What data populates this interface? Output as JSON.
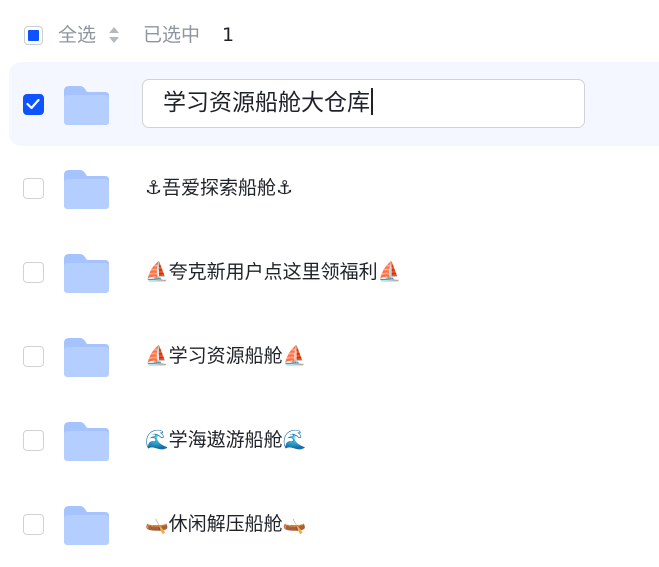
{
  "header": {
    "select_all_label": "全选",
    "selected_label": "已选中",
    "selected_count": "1"
  },
  "editing": {
    "value": "学习资源船舱大仓库"
  },
  "folders": [
    {
      "name": "⚓吾爱探索船舱⚓",
      "checked": false
    },
    {
      "name": "⛵夸克新用户点这里领福利⛵",
      "checked": false
    },
    {
      "name": "⛵学习资源船舱⛵",
      "checked": false
    },
    {
      "name": "🌊学海遨游船舱🌊",
      "checked": false
    },
    {
      "name": "🛶休闲解压船舱🛶",
      "checked": false
    }
  ],
  "colors": {
    "accent": "#0d53ff",
    "folder": "#a5c3ff",
    "selected_row_bg": "#f4f7ff"
  }
}
